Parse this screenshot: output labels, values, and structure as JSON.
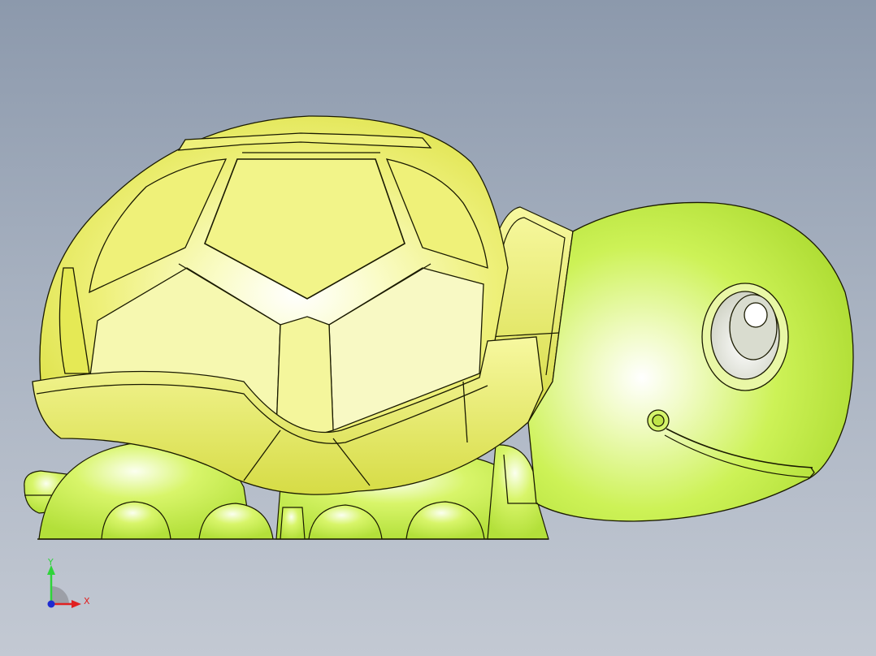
{
  "viewport": {
    "background_top": "#8c99ac",
    "background_bottom": "#c3c9d3"
  },
  "model": {
    "shell_color": "#eef07a",
    "body_color": "#cdf257",
    "edge_color": "#1a1a00",
    "eye_white": "#f3f3ea"
  },
  "triad": {
    "y_label": "Y",
    "x_label": "X",
    "y_color": "#2fd43a",
    "x_color": "#e02020",
    "origin_color": "#1e2bd0"
  }
}
